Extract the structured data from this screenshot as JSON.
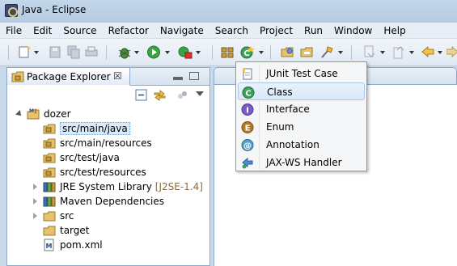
{
  "window": {
    "title": "Java - Eclipse"
  },
  "menubar": {
    "items": [
      "File",
      "Edit",
      "Source",
      "Refactor",
      "Navigate",
      "Search",
      "Project",
      "Run",
      "Window",
      "Help"
    ]
  },
  "package_explorer": {
    "tab_label": "Package Explorer",
    "close_glyph": "☒",
    "tree": [
      {
        "label": "dozer",
        "icon": "java-project-icon",
        "expanded": true
      },
      {
        "label": "src/main/java",
        "icon": "source-folder-icon",
        "selected": true
      },
      {
        "label": "src/main/resources",
        "icon": "source-folder-icon"
      },
      {
        "label": "src/test/java",
        "icon": "source-folder-icon"
      },
      {
        "label": "src/test/resources",
        "icon": "source-folder-icon"
      },
      {
        "label": "JRE System Library",
        "decoration": "[J2SE-1.4]",
        "icon": "library-icon"
      },
      {
        "label": "Maven Dependencies",
        "icon": "library-icon"
      },
      {
        "label": "src",
        "icon": "folder-icon"
      },
      {
        "label": "target",
        "icon": "folder-icon"
      },
      {
        "label": "pom.xml",
        "icon": "xml-file-icon"
      }
    ]
  },
  "new_java_menu": {
    "items": [
      {
        "label": "JUnit Test Case",
        "icon": "junit-icon"
      },
      {
        "label": "Class",
        "icon": "class-icon",
        "highlighted": true
      },
      {
        "label": "Interface",
        "icon": "interface-icon"
      },
      {
        "label": "Enum",
        "icon": "enum-icon"
      },
      {
        "label": "Annotation",
        "icon": "annotation-icon"
      },
      {
        "label": "JAX-WS Handler",
        "icon": "jaxws-handler-icon"
      }
    ]
  },
  "colors": {
    "selection_bg": "#dceafc",
    "menu_highlight": "#d9e8f9",
    "decoration_text": "#8a6d3b"
  }
}
